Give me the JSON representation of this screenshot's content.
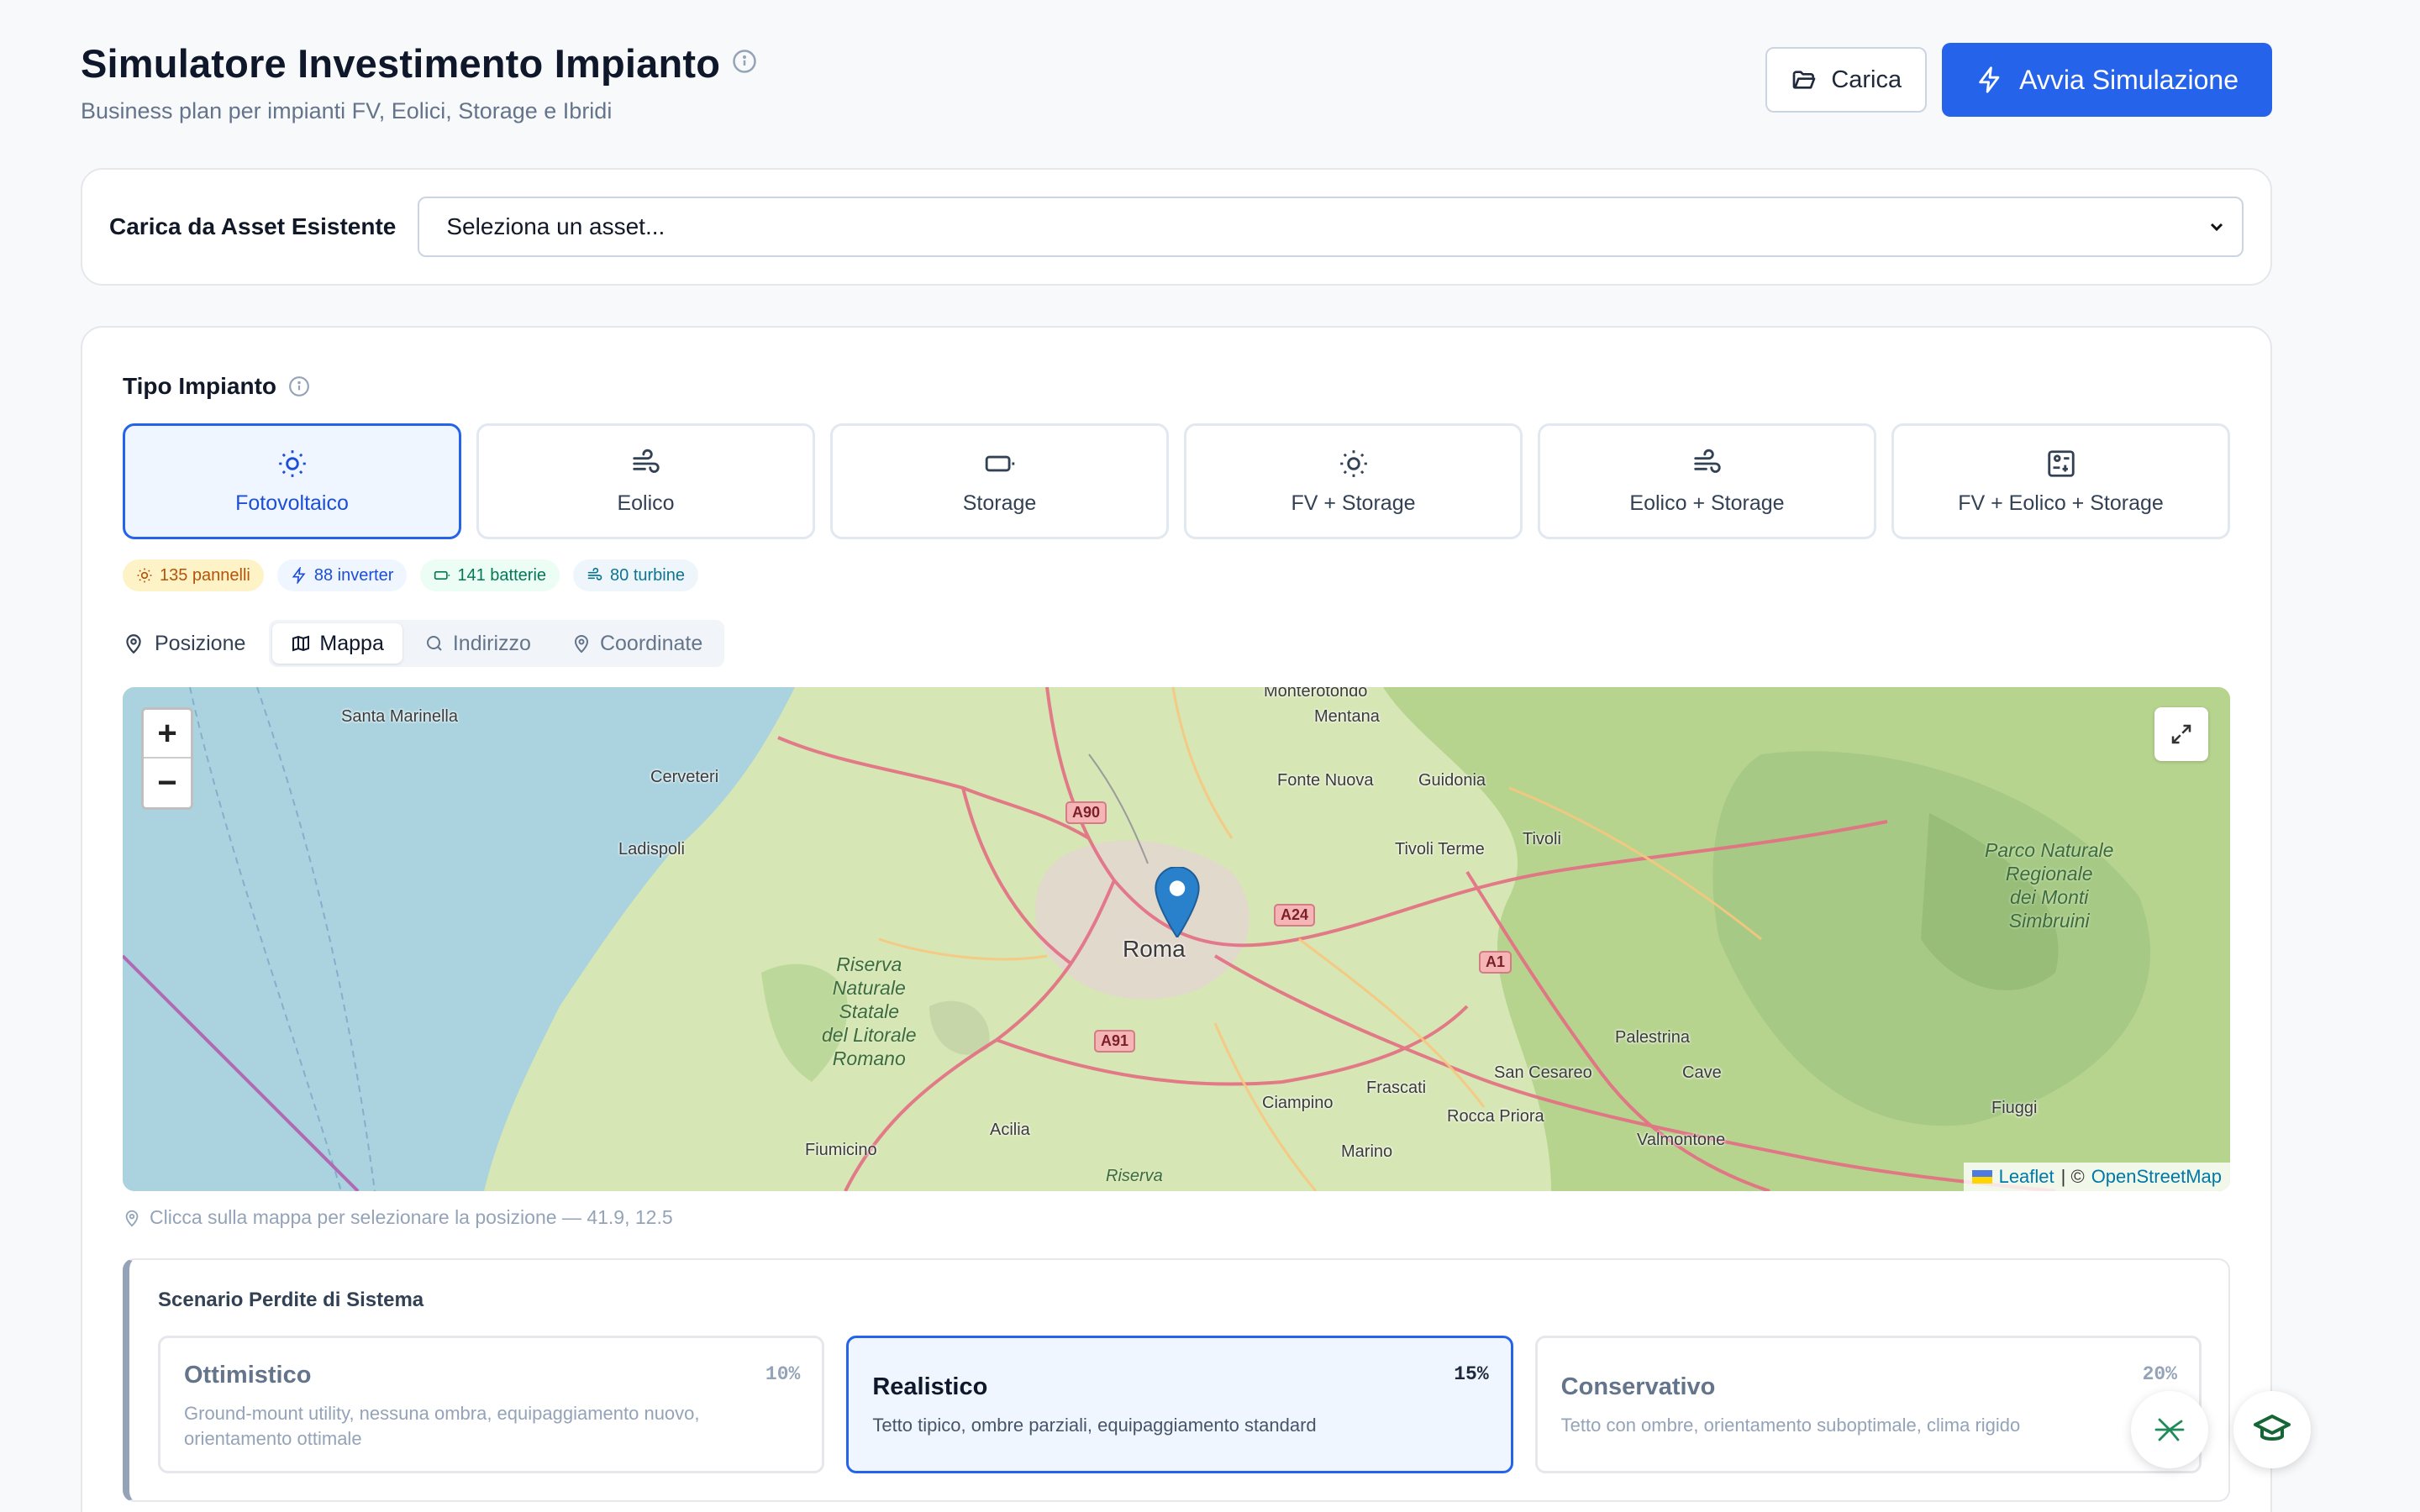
{
  "header": {
    "title": "Simulatore Investimento Impianto",
    "subtitle": "Business plan per impianti FV, Eolici, Storage e Ibridi",
    "load_label": "Carica",
    "run_label": "Avvia Simulazione"
  },
  "asset": {
    "label": "Carica da Asset Esistente",
    "select_value": "Seleziona un asset..."
  },
  "plant_type": {
    "title": "Tipo Impianto",
    "options": [
      {
        "label": "Fotovoltaico",
        "icon": "sun-icon",
        "selected": true
      },
      {
        "label": "Eolico",
        "icon": "wind-icon",
        "selected": false
      },
      {
        "label": "Storage",
        "icon": "battery-icon",
        "selected": false
      },
      {
        "label": "FV + Storage",
        "icon": "sun-icon",
        "selected": false
      },
      {
        "label": "Eolico + Storage",
        "icon": "wind-icon",
        "selected": false
      },
      {
        "label": "FV + Eolico + Storage",
        "icon": "hybrid-icon",
        "selected": false
      }
    ]
  },
  "counts": {
    "panels": "135 pannelli",
    "inverters": "88 inverter",
    "batteries": "141 batterie",
    "turbines": "80 turbine"
  },
  "position": {
    "label": "Posizione",
    "tabs": [
      "Mappa",
      "Indirizzo",
      "Coordinate"
    ],
    "active_tab": "Mappa",
    "hint": "Clicca sulla mappa per selezionare la posizione — 41.9, 12.5"
  },
  "map": {
    "attribution_leaflet": "Leaflet",
    "attribution_sep": "| ©",
    "attribution_osm": "OpenStreetMap",
    "zoom_in": "+",
    "zoom_out": "−",
    "labels": {
      "roma": "Roma",
      "santa_marinella": "Santa Marinella",
      "cerveteri": "Cerveteri",
      "ladispoli": "Ladispoli",
      "monterotondo": "Monterotondo",
      "mentana": "Mentana",
      "fonte_nuova": "Fonte Nuova",
      "guidonia": "Guidonia",
      "tivoli_terme": "Tivoli Terme",
      "tivoli": "Tivoli",
      "palestrina": "Palestrina",
      "san_cesareo": "San Cesareo",
      "cave": "Cave",
      "fiuggi": "Fiuggi",
      "ciampino": "Ciampino",
      "frascati": "Frascati",
      "rocca_priora": "Rocca Priora",
      "valmontone": "Valmontone",
      "marino": "Marino",
      "acilia": "Acilia",
      "fiumicino": "Fiumicino",
      "riserva": "Riserva",
      "park_monti": "Parco Naturale\nRegionale\ndei Monti\nSimbruini",
      "riserva_litorale": "Riserva\nNaturale\nStatale\ndel Litorale\nRomano",
      "a90": "A90",
      "a24": "A24",
      "a1": "A1",
      "a91": "A91"
    }
  },
  "scenario": {
    "title": "Scenario Perdite di Sistema",
    "options": [
      {
        "name": "Ottimistico",
        "pct": "10%",
        "desc": "Ground-mount utility, nessuna ombra, equipaggiamento nuovo, orientamento ottimale",
        "selected": false
      },
      {
        "name": "Realistico",
        "pct": "15%",
        "desc": "Tetto tipico, ombre parziali, equipaggiamento standard",
        "selected": true
      },
      {
        "name": "Conservativo",
        "pct": "20%",
        "desc": "Tetto con ombre, orientamento suboptimale, clima rigido",
        "selected": false
      }
    ]
  },
  "colors": {
    "accent": "#2563eb",
    "accent_bg": "#eff6ff"
  }
}
